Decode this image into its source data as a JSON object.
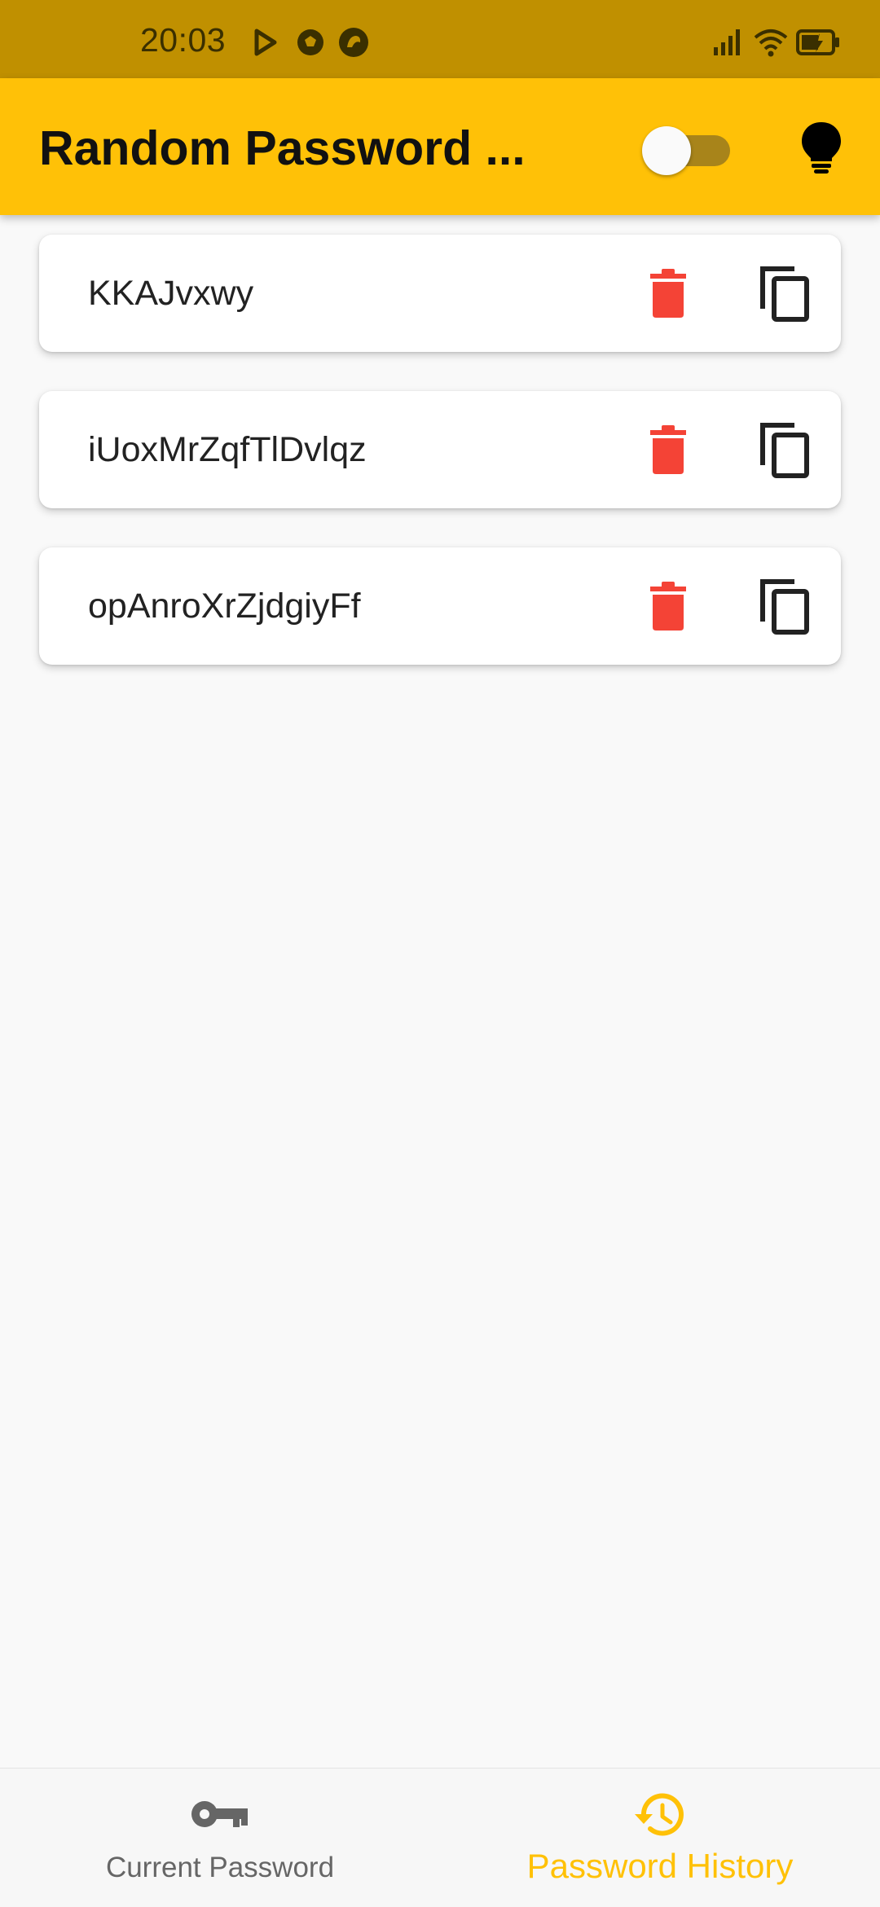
{
  "status_bar": {
    "time": "20:03",
    "left_icons": [
      "play-store-icon",
      "soccer-ball-icon",
      "notification-app-icon"
    ],
    "right_icons": [
      "signal-icon",
      "wifi-icon",
      "battery-charging-icon"
    ]
  },
  "app_bar": {
    "title": "Random Password ...",
    "theme_toggle_on": false,
    "bulb_icon": "lightbulb-icon"
  },
  "passwords": [
    {
      "value": "KKAJvxwy"
    },
    {
      "value": "iUoxMrZqfTlDvlqz"
    },
    {
      "value": "opAnroXrZjdgiyFf"
    }
  ],
  "bottom_nav": {
    "items": [
      {
        "label": "Current Password",
        "icon": "key-icon",
        "active": false
      },
      {
        "label": "Password History",
        "icon": "history-icon",
        "active": true
      }
    ]
  },
  "colors": {
    "accent": "#ffc107",
    "status_bar": "#c09000",
    "delete": "#f44336",
    "background": "#f9f9f9"
  }
}
